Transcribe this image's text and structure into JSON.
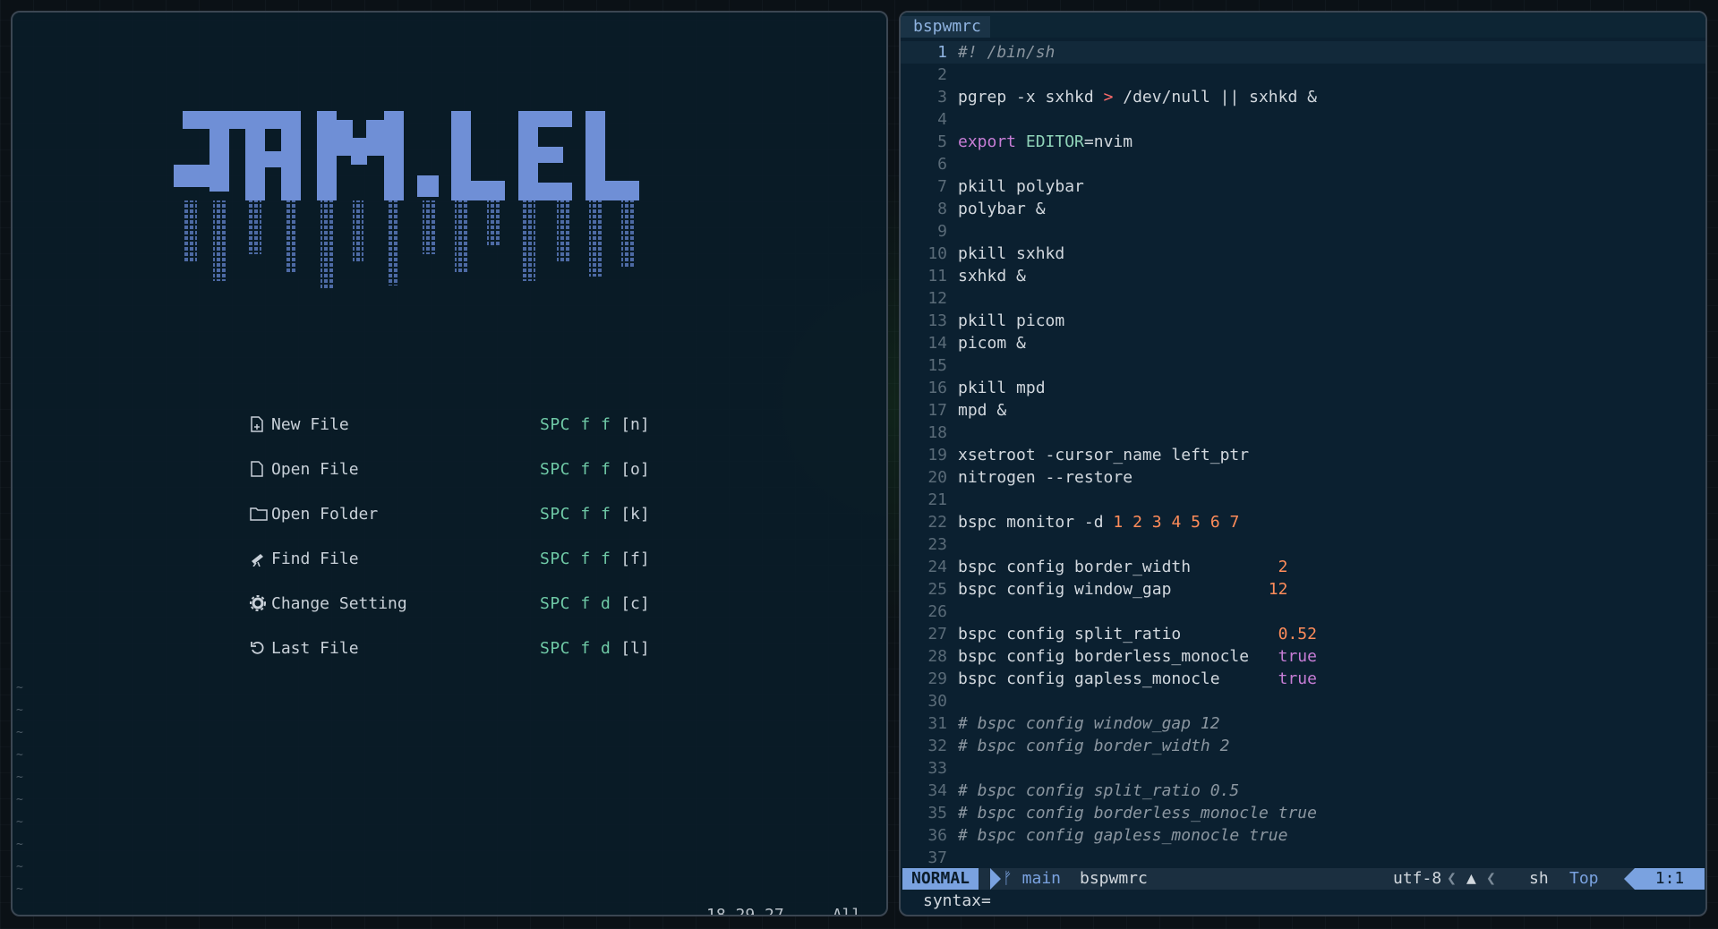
{
  "dashboard": {
    "banner_text": "JAMLEL",
    "items": [
      {
        "icon": "new-file-icon",
        "label": "New File",
        "key": "SPC f f",
        "key_arg": "[n]"
      },
      {
        "icon": "file-icon",
        "label": "Open File",
        "key": "SPC f f",
        "key_arg": "[o]"
      },
      {
        "icon": "folder-icon",
        "label": "Open Folder",
        "key": "SPC f f",
        "key_arg": "[k]"
      },
      {
        "icon": "telescope-icon",
        "label": "Find File",
        "key": "SPC f f",
        "key_arg": "[f]"
      },
      {
        "icon": "gear-icon",
        "label": "Change Setting",
        "key": "SPC f d",
        "key_arg": "[c]"
      },
      {
        "icon": "history-icon",
        "label": "Last File",
        "key": "SPC f d",
        "key_arg": "[l]"
      }
    ],
    "status_position": "18,29-27",
    "status_percent": "All"
  },
  "editor": {
    "tab_name": "bspwmrc",
    "lines": [
      "#! /bin/sh",
      "",
      "pgrep -x sxhkd > /dev/null || sxhkd &",
      "",
      "export EDITOR=nvim",
      "",
      "pkill polybar",
      "polybar &",
      "",
      "pkill sxhkd",
      "sxhkd &",
      "",
      "pkill picom",
      "picom &",
      "",
      "pkill mpd",
      "mpd &",
      "",
      "xsetroot -cursor_name left_ptr",
      "nitrogen --restore",
      "",
      "bspc monitor -d 1 2 3 4 5 6 7",
      "",
      "bspc config border_width         2",
      "bspc config window_gap          12",
      "",
      "bspc config split_ratio          0.52",
      "bspc config borderless_monocle   true",
      "bspc config gapless_monocle      true",
      "",
      "# bspc config window_gap 12",
      "# bspc config border_width 2",
      "",
      "# bspc config split_ratio 0.5",
      "# bspc config borderless_monocle true",
      "# bspc config gapless_monocle true",
      ""
    ],
    "status": {
      "mode": "NORMAL",
      "branch": "main",
      "filename": "bspwmrc",
      "encoding": "utf-8",
      "filetype": "sh",
      "scroll": "Top",
      "cursor": "1:1"
    },
    "cmdline": "syntax="
  },
  "colors": {
    "accent": "#7aa2e0",
    "keymap": "#6fc9a6",
    "number": "#ff8c5a",
    "keyword": "#c77dd6",
    "operator": "#ff6b6b"
  }
}
